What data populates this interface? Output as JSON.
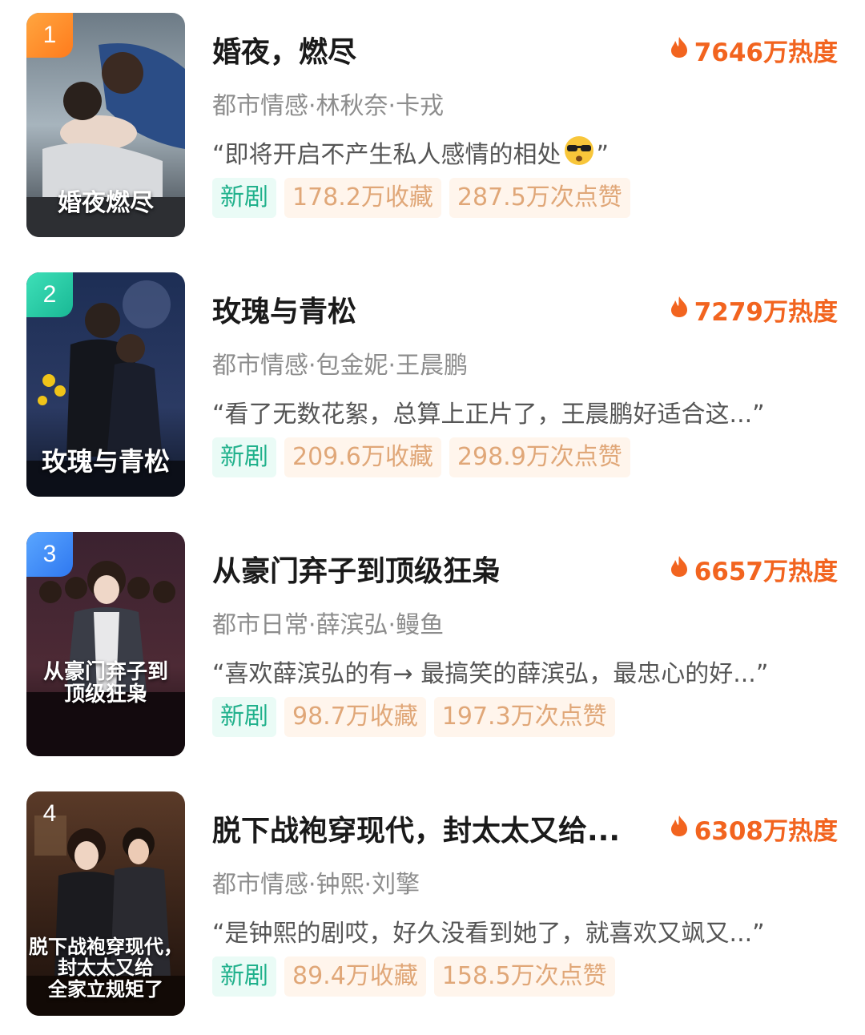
{
  "items": [
    {
      "rank": "1",
      "title": "婚夜，燃尽",
      "heat": "7646万热度",
      "meta": "都市情感·林秋奈·卡戎",
      "quote_open": "“即将开启不产生私人感情的相处",
      "quote_close": "”",
      "emoji": "sunglasses-face",
      "tag_new": "新剧",
      "collect": "178.2万收藏",
      "likes": "287.5万次点赞",
      "poster_text": "婚夜燃尽",
      "rank_color": "#ff8a24"
    },
    {
      "rank": "2",
      "title": "玫瑰与青松",
      "heat": "7279万热度",
      "meta": "都市情感·包金妮·王晨鹏",
      "quote": "“看了无数花絮，总算上正片了，王晨鹏好适合这...”",
      "tag_new": "新剧",
      "collect": "209.6万收藏",
      "likes": "298.9万次点赞",
      "poster_text": "玫瑰与青松",
      "rank_color": "#22c29e"
    },
    {
      "rank": "3",
      "title": "从豪门弃子到顶级狂枭",
      "heat": "6657万热度",
      "meta": "都市日常·薛滨弘·鳗鱼",
      "quote": "“喜欢薛滨弘的有→ 最搞笑的薛滨弘，最忠心的好...”",
      "tag_new": "新剧",
      "collect": "98.7万收藏",
      "likes": "197.3万次点赞",
      "poster_text": "从豪门弃子到\n顶级狂枭",
      "rank_color": "#3d86f5"
    },
    {
      "rank": "4",
      "title": "脱下战袍穿现代，封太太又给...",
      "heat": "6308万热度",
      "meta": "都市情感·钟熙·刘擎",
      "quote": "“是钟熙的剧哎，好久没看到她了，就喜欢又飒又...”",
      "tag_new": "新剧",
      "collect": "89.4万收藏",
      "likes": "158.5万次点赞",
      "poster_text": "脱下战袍穿现代，\n封太太又给\n全家立规矩了",
      "rank_color": "#5a3a28"
    }
  ],
  "colors": {
    "heat": "#f2641f",
    "new_tag_text": "#21b18c",
    "new_tag_bg": "#eafbf6",
    "stat_tag_text": "#e0a778",
    "stat_tag_bg": "#fff5ec"
  }
}
